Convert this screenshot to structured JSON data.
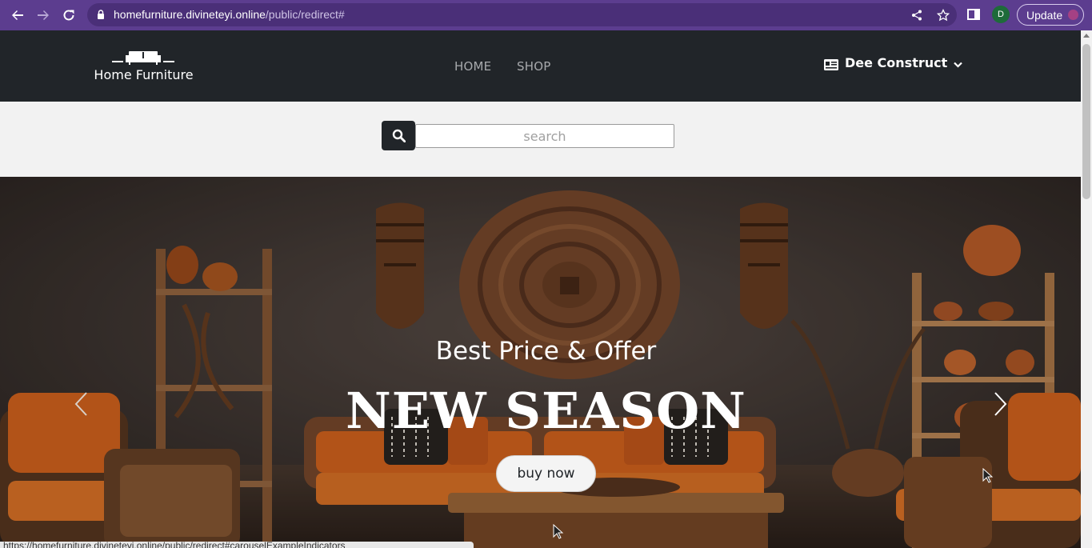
{
  "browser": {
    "url_host": "homefurniture.divineteyi.online",
    "url_path": "/public/redirect#",
    "profile_initial": "D",
    "update_label": "Update",
    "status_url": "https://homefurniture.divineteyi.online/public/redirect#carouselExampleIndicators"
  },
  "header": {
    "logo_text": "Home Furniture",
    "nav": [
      {
        "label": "HOME"
      },
      {
        "label": "SHOP"
      }
    ],
    "account_name": "Dee Construct"
  },
  "search": {
    "placeholder": "search"
  },
  "hero": {
    "subtitle": "Best Price & Offer",
    "title": "NEW SEASON",
    "cta_label": "buy now"
  },
  "colors": {
    "browser_chrome": "#5c3d8f",
    "header_bg": "#212529",
    "page_bg": "#f2f2f2",
    "sofa_orange": "#d9661e"
  },
  "icons": [
    "back-icon",
    "forward-icon",
    "reload-icon",
    "lock-icon",
    "share-icon",
    "star-icon",
    "side-panel-icon",
    "id-card-icon",
    "chevron-down-icon",
    "search-icon",
    "chevron-left-icon",
    "chevron-right-icon"
  ]
}
